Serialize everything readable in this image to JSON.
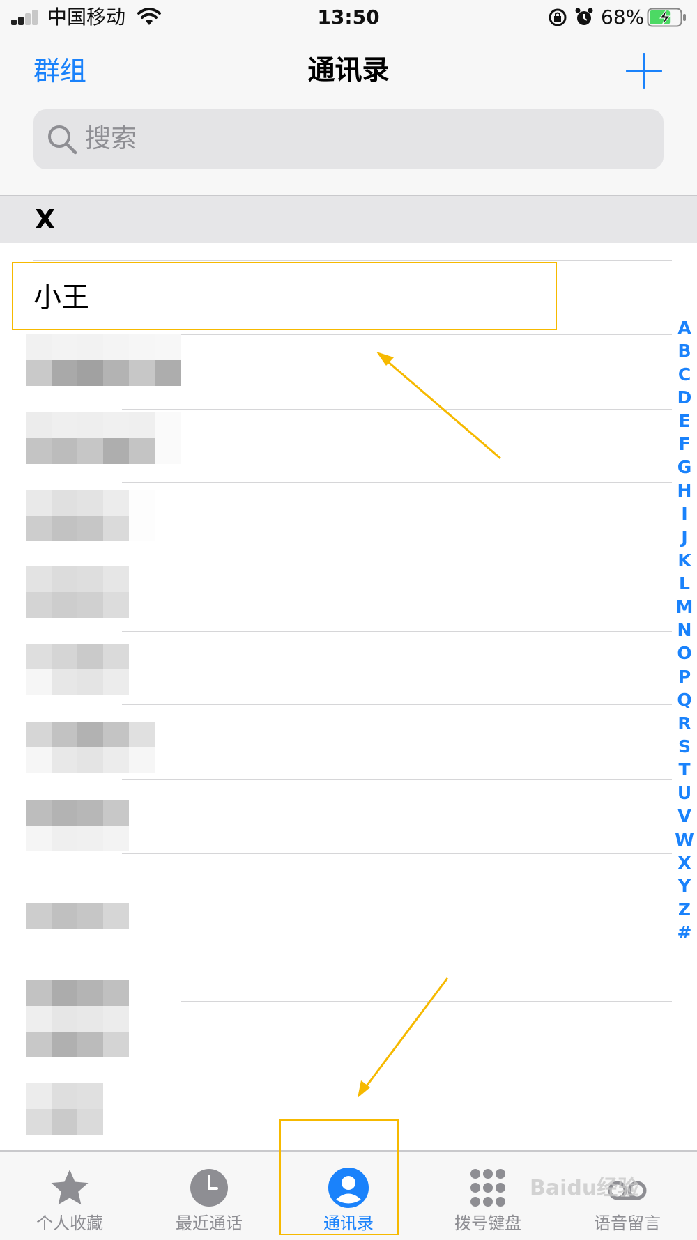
{
  "status_bar": {
    "carrier": "中国移动",
    "time": "13:50",
    "battery_percent": "68%",
    "battery_level": 0.68,
    "icons": [
      "signal-icon",
      "wifi-icon",
      "rotation-lock-icon",
      "alarm-icon",
      "battery-charging-icon"
    ]
  },
  "header": {
    "groups_label": "群组",
    "title": "通讯录",
    "add_icon": "plus-icon"
  },
  "search": {
    "placeholder": "搜索",
    "icon": "search-icon"
  },
  "section": {
    "letter": "X"
  },
  "contacts": [
    {
      "name": "小王",
      "highlighted": true
    }
  ],
  "alphabet_index": [
    "A",
    "B",
    "C",
    "D",
    "E",
    "F",
    "G",
    "H",
    "I",
    "J",
    "K",
    "L",
    "M",
    "N",
    "O",
    "P",
    "Q",
    "R",
    "S",
    "T",
    "U",
    "V",
    "W",
    "X",
    "Y",
    "Z",
    "#"
  ],
  "tab_bar": {
    "tabs": [
      {
        "label": "个人收藏",
        "icon": "star-icon",
        "active": false
      },
      {
        "label": "最近通话",
        "icon": "clock-icon",
        "active": false
      },
      {
        "label": "通讯录",
        "icon": "person-circle-icon",
        "active": true
      },
      {
        "label": "拨号键盘",
        "icon": "keypad-icon",
        "active": false
      },
      {
        "label": "语音留言",
        "icon": "voicemail-icon",
        "active": false
      }
    ]
  },
  "watermark": "Baidu经验",
  "colors": {
    "accent": "#1a82fb",
    "annotation": "#f6b900",
    "inactive": "#8e8e93"
  }
}
